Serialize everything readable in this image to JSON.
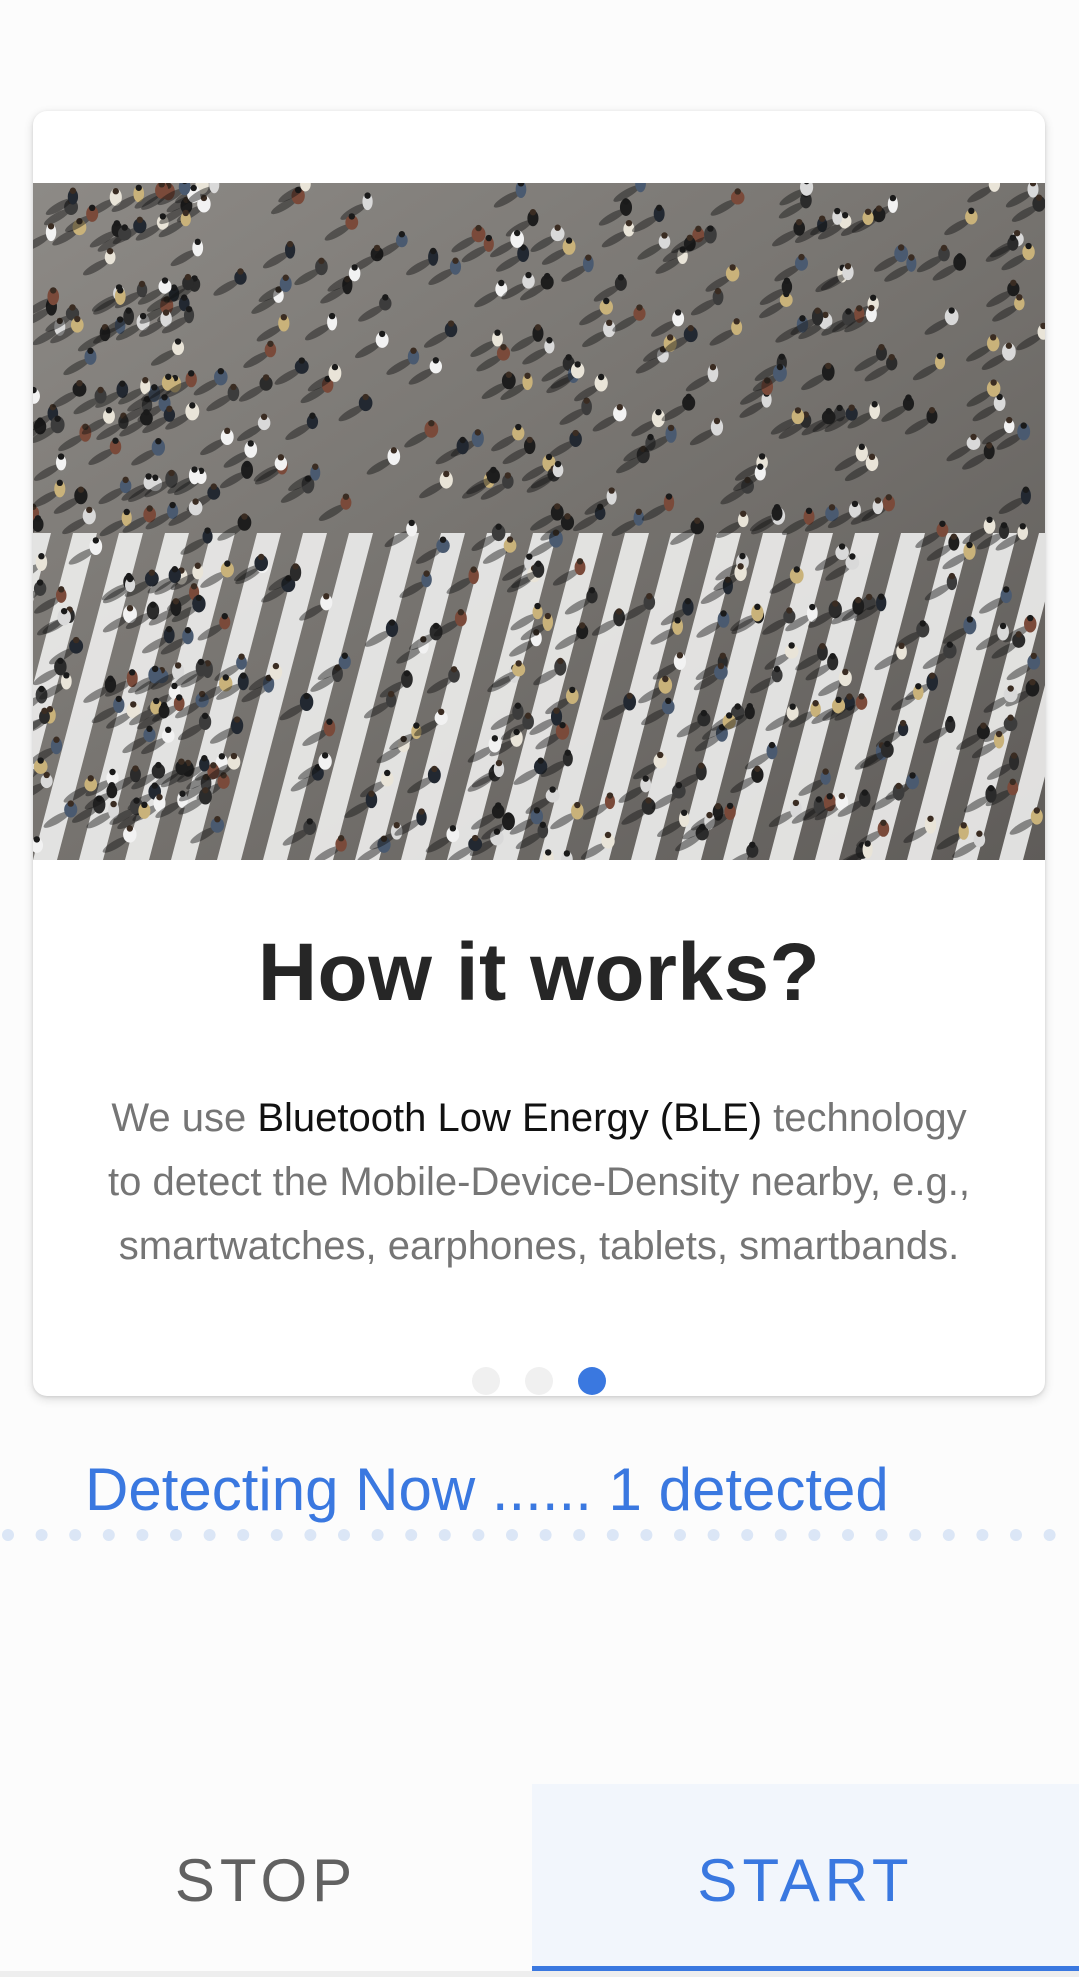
{
  "onboarding": {
    "title": "How it works?",
    "body": {
      "intro": "We use ",
      "highlight": "Bluetooth Low Energy (BLE)",
      "rest": " technology to detect the Mobile-Device-Density nearby, e.g., smartwatches, earphones, tablets, smartbands."
    },
    "page_indicator": {
      "total": 3,
      "current": 3
    },
    "image_icon": "crowd-crosswalk-photo"
  },
  "detection": {
    "status_text": "Detecting Now ...... 1 detected",
    "detected_count": 1
  },
  "tabs": [
    {
      "label": "STOP",
      "selected": false
    },
    {
      "label": "START",
      "selected": true
    }
  ],
  "colors": {
    "accent": "#3a78e0",
    "title": "#262626",
    "body_text": "#757575",
    "highlight_text": "#111111",
    "inactive_tab": "#616161"
  }
}
